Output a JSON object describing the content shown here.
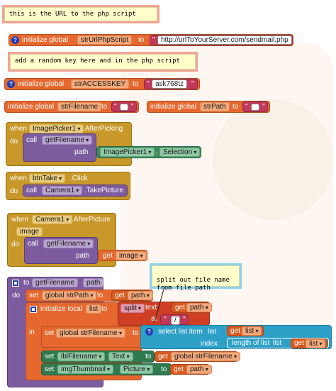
{
  "comments": {
    "c1": "this is the URL to the php script",
    "c2": "add a random key here and in the php script",
    "c3": "split out file name\nfrom file path"
  },
  "globals": {
    "init_label": "initialize global",
    "to_label": "to",
    "url_var": "strUrlPhpScript",
    "url_value": "http://urlToYourServer.com/sendmail.php",
    "key_var": "strACCESSKEY",
    "key_value": "ask768tz",
    "filename_var": "strFilename",
    "path_var": "strPath",
    "empty_quote_open": "\"",
    "empty_quote_close": "\""
  },
  "picker": {
    "when": "when",
    "component": "ImagePicker1",
    "event": ".AfterPicking",
    "do": "do",
    "call": "call",
    "proc": "getFilename",
    "path_label": "path",
    "getter_component": "ImagePicker1",
    "getter_prop": "Selection"
  },
  "take": {
    "when": "when",
    "component": "btnTake",
    "event": ".Click",
    "do": "do",
    "call": "call",
    "callee": "Camera1",
    "method": ".TakePicture"
  },
  "camera": {
    "when": "when",
    "component": "Camera1",
    "event": ".AfterPicture",
    "param": "image",
    "do": "do",
    "call": "call",
    "proc": "getFilename",
    "path_label": "path",
    "get": "get",
    "get_var": "image"
  },
  "proc": {
    "to": "to",
    "name": "getFilename",
    "param": "path",
    "do": "do",
    "set": "set",
    "set_var1": "global strPath",
    "to1": "to",
    "get": "get",
    "get_path": "path",
    "init_local": "initialize local",
    "local_var": "list",
    "to2": "to",
    "split": "split",
    "text": "text",
    "at": "at",
    "at_value": "/",
    "in": "in",
    "set_var2": "global strFilename",
    "to3": "to",
    "select": "select list item",
    "list_label": "list",
    "get_list": "list",
    "index": "index",
    "length": "length of list",
    "length_list": "list",
    "set_var3": "lblFilename",
    "set_prop3": "Text",
    "get_global_filename": "global strFilename",
    "set_var4": "imgThumbnail",
    "set_prop4": "Picture"
  },
  "colors": {
    "variables": "#e6682f",
    "procedures": "#7c5c9e",
    "events": "#c8982a",
    "text": "#c2385a",
    "lists": "#2ea0c8",
    "components": "#3f8a5a",
    "help": "#1b3fb5"
  }
}
